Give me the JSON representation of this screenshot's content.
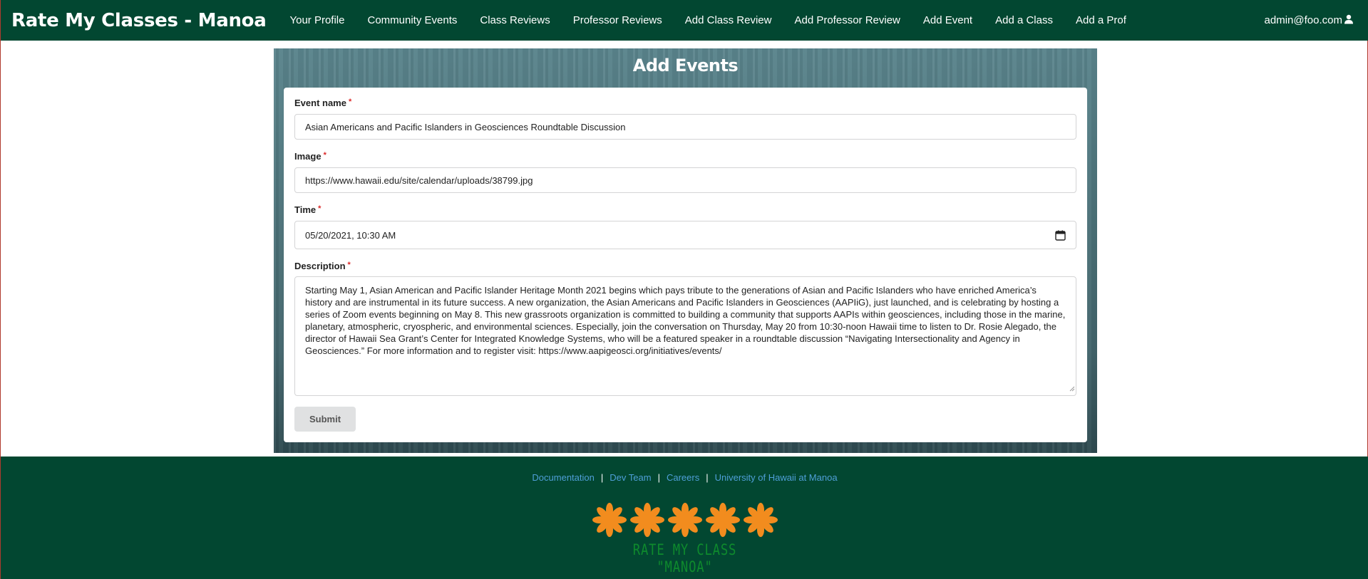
{
  "navbar": {
    "brand": "Rate My Classes - Manoa",
    "items": [
      {
        "label": "Your Profile"
      },
      {
        "label": "Community Events"
      },
      {
        "label": "Class Reviews"
      },
      {
        "label": "Professor Reviews"
      },
      {
        "label": "Add Class Review"
      },
      {
        "label": "Add Professor Review"
      },
      {
        "label": "Add Event"
      },
      {
        "label": "Add a Class"
      },
      {
        "label": "Add a Prof"
      }
    ],
    "user": "admin@foo.com",
    "user_icon": "user-icon"
  },
  "form": {
    "title": "Add Events",
    "required_marker": "*",
    "event_name": {
      "label": "Event name",
      "value": "Asian Americans and Pacific Islanders in Geosciences Roundtable Discussion"
    },
    "image": {
      "label": "Image",
      "value": "https://www.hawaii.edu/site/calendar/uploads/38799.jpg"
    },
    "time": {
      "label": "Time",
      "value": "05/20/2021, 10:30 AM",
      "icon": "calendar-icon"
    },
    "description": {
      "label": "Description",
      "value": "Starting May 1, Asian American and Pacific Islander Heritage Month 2021 begins which pays tribute to the generations of Asian and Pacific Islanders who have enriched America’s history and are instrumental in its future success. A new organization, the Asian Americans and Pacific Islanders in Geosciences (AAPIiG), just launched, and is celebrating by hosting a series of Zoom events beginning on May 8. This new grassroots organization is committed to building a community that supports AAPIs within geosciences, including those in the marine, planetary, atmospheric, cryospheric, and environmental sciences. Especially, join the conversation on Thursday, May 20 from 10:30-noon Hawaii time to listen to Dr. Rosie Alegado, the director of Hawaii Sea Grant’s Center for Integrated Knowledge Systems, who will be a featured speaker in a roundtable discussion “Navigating Intersectionality and Agency in Geosciences.” For more information and to register visit: https://www.aapigeosci.org/initiatives/events/"
    },
    "submit_label": "Submit"
  },
  "footer": {
    "links": [
      {
        "label": "Documentation"
      },
      {
        "label": "Dev Team"
      },
      {
        "label": "Careers"
      },
      {
        "label": "University of Hawaii at Manoa"
      }
    ],
    "separator": "|",
    "logo_text": "RATE MY CLASS \"MANOA\"",
    "logo_icon": "asterisk-flower-icon"
  },
  "colors": {
    "navbar_bg": "#024731",
    "footer_bg": "#024731",
    "footer_link": "#4f9fd8",
    "logo_flower": "#f28c1e",
    "logo_text": "#0e8a2d",
    "required": "#db2828"
  }
}
